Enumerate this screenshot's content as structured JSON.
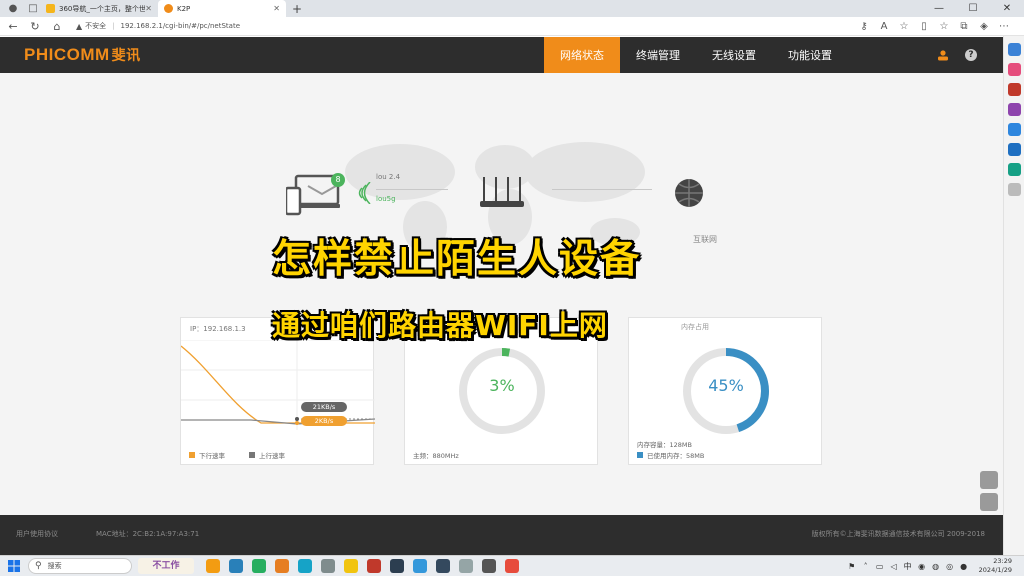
{
  "browser": {
    "tabs": [
      {
        "title": "360导航_一个主页，整个世界",
        "active": false
      },
      {
        "title": "K2P",
        "active": true
      }
    ],
    "address": {
      "security_label": "不安全",
      "url": "192.168.2.1/cgi-bin/#/pc/netState"
    }
  },
  "router": {
    "brand": "PHICOMM",
    "brand_cn": "斐讯",
    "menu": [
      {
        "label": "网络状态",
        "active": true
      },
      {
        "label": "终端管理",
        "active": false
      },
      {
        "label": "无线设置",
        "active": false
      },
      {
        "label": "功能设置",
        "active": false
      }
    ],
    "topology": {
      "device_count": "8",
      "ssids": [
        "lou 2.4",
        "lou5g"
      ],
      "internet_label": "互联网"
    },
    "cards": {
      "traffic": {
        "ip": "IP：192.168.1.3",
        "download_rate": "21KB/s",
        "upload_rate": "2KB/s",
        "legend_down": "下行速率",
        "legend_up": "上行速率"
      },
      "cpu": {
        "percent": 3,
        "percent_label": "3%",
        "freq": "主频：880MHz"
      },
      "memory": {
        "header": "内存占用",
        "percent": 45,
        "percent_label": "45%",
        "total": "内存容量：128MB",
        "used": "已使用内存：58MB"
      }
    },
    "footer": {
      "agreement": "用户使用协议",
      "mac": "MAC地址：2C:B2:1A:97:A3:71",
      "copyright": "版权所有©上海斐讯数据通信技术有限公司 2009-2018"
    }
  },
  "caption": {
    "line1": "怎样禁止陌生人设备",
    "line2": "通过咱们路由器WIFI上网"
  },
  "taskbar": {
    "search_placeholder": "搜索",
    "art_text": "不工作",
    "ime": "中",
    "time": "23:29",
    "date": "2024/1/29"
  },
  "colors": {
    "accent": "#f08c1a",
    "nav_bg": "#2d2d2d",
    "cpu_green": "#4cb45d",
    "mem_blue": "#3a8fc4",
    "caption": "#ffd400"
  }
}
